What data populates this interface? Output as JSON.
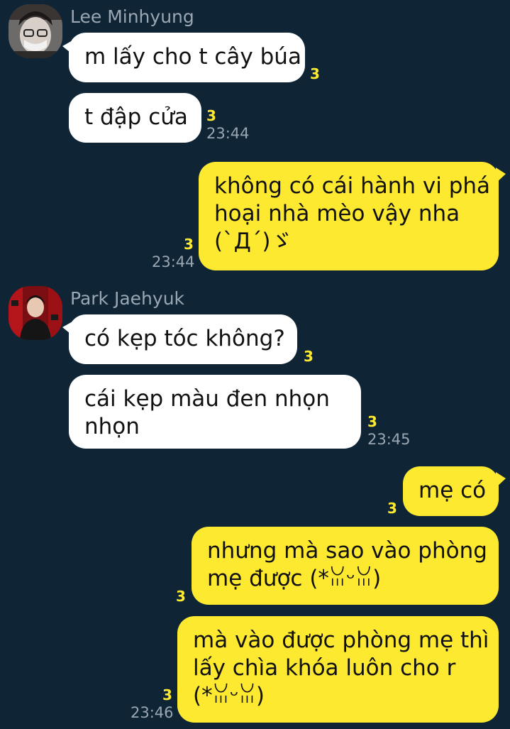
{
  "senders": {
    "lee": "Lee Minhyung",
    "park": "Park Jaehyuk"
  },
  "messages": [
    {
      "text": "m lấy cho t cây búa",
      "unread": "3",
      "time": ""
    },
    {
      "text": "t đập cửa",
      "unread": "3",
      "time": "23:44"
    },
    {
      "line1": "không có cái hành vi phá",
      "line2": "hoại nhà mèo vậy nha",
      "line3": "(`Д´)ゞ",
      "unread": "3",
      "time": "23:44"
    },
    {
      "text": "có kẹp tóc không?",
      "unread": "3",
      "time": ""
    },
    {
      "line1": "cái kẹp màu đen nhọn",
      "line2": "nhọn",
      "unread": "3",
      "time": "23:45"
    },
    {
      "text": "mẹ có",
      "unread": "3",
      "time": ""
    },
    {
      "line1": "nhưng mà sao vào phòng",
      "line2": "mẹ được (*ꈍᵕꈍ)",
      "unread": "3",
      "time": ""
    },
    {
      "line1": "mà vào được phòng mẹ thì",
      "line2": "lấy chìa khóa luôn cho r",
      "line3": "(*ꈍᵕꈍ)",
      "unread": "3",
      "time": "23:46"
    }
  ],
  "colors": {
    "background": "#0f2536",
    "incoming_bubble": "#ffffff",
    "outgoing_bubble": "#fde92f",
    "unread_count": "#fde92f",
    "meta_text": "#9aa7b2"
  }
}
